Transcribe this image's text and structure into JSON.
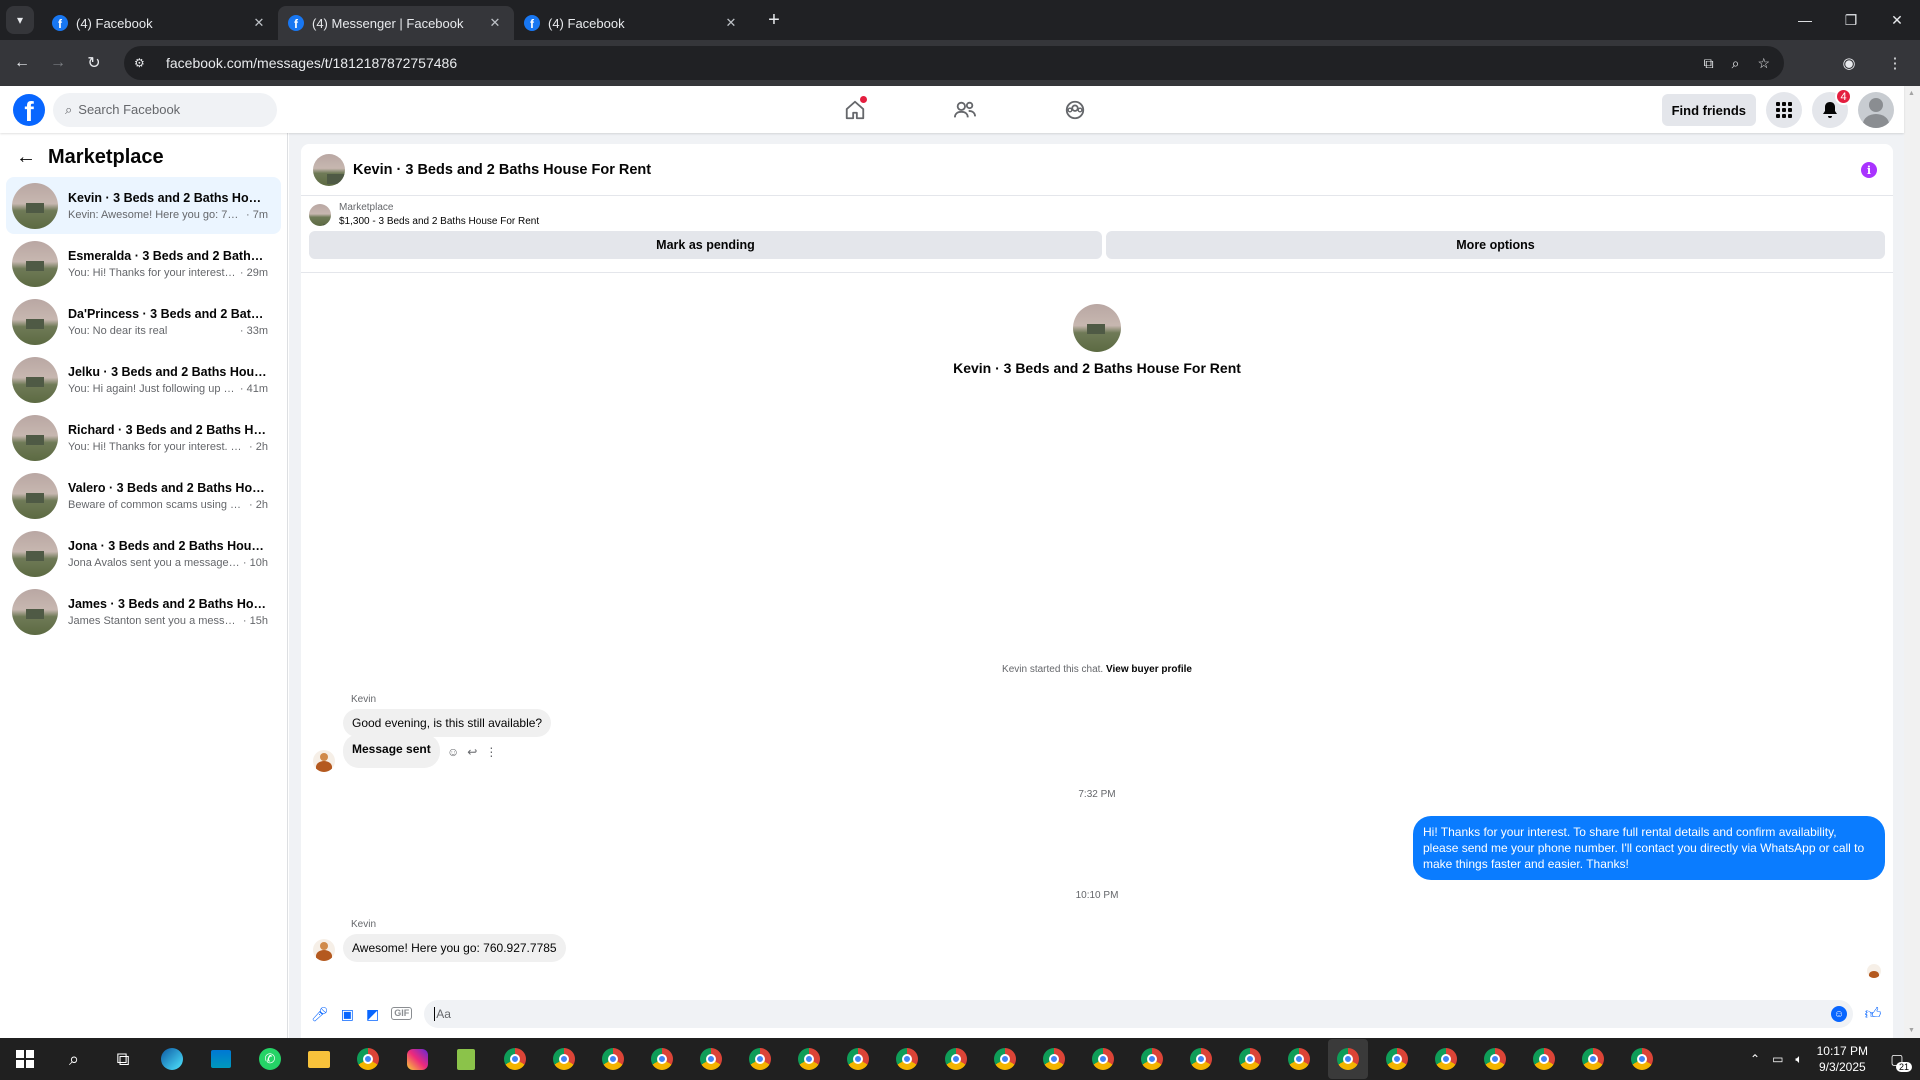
{
  "browser": {
    "tabs": [
      {
        "title": "(4) Facebook",
        "active": false
      },
      {
        "title": "(4) Messenger | Facebook",
        "active": true
      },
      {
        "title": "(4) Facebook",
        "active": false
      }
    ],
    "url": "facebook.com/messages/t/1812187872757486"
  },
  "fb_header": {
    "search_placeholder": "Search Facebook",
    "find_friends_label": "Find friends",
    "notification_count": "4"
  },
  "left_panel": {
    "title": "Marketplace",
    "conversations": [
      {
        "name": "Kevin · 3 Beds and 2 Baths House ...",
        "last": "Kevin: Awesome! Here you go: 760.9...",
        "time": "· 7m",
        "active": true
      },
      {
        "name": "Esmeralda · 3 Beds and 2 Baths Ho...",
        "last": "You: Hi! Thanks for your interest. To ...",
        "time": "· 29m",
        "active": false
      },
      {
        "name": "Da'Princess · 3 Beds and 2 Baths H...",
        "last": "You: No dear its real",
        "time": "· 33m",
        "active": false
      },
      {
        "name": "Jelku · 3 Beds and 2 Baths House F...",
        "last": "You: Hi again! Just following up in c...",
        "time": "· 41m",
        "active": false
      },
      {
        "name": "Richard · 3 Beds and 2 Baths Hous...",
        "last": "You: Hi! Thanks for your interest. To sh...",
        "time": "· 2h",
        "active": false
      },
      {
        "name": "Valero · 3 Beds and 2 Baths House ...",
        "last": "Beware of common scams using pay...",
        "time": "· 2h",
        "active": false
      },
      {
        "name": "Jona · 3 Beds and 2 Baths House F...",
        "last": "Jona Avalos sent you a message abo...",
        "time": "· 10h",
        "active": false
      },
      {
        "name": "James · 3 Beds and 2 Baths House ...",
        "last": "James Stanton sent you a message a...",
        "time": "· 15h",
        "active": false
      }
    ]
  },
  "chat": {
    "title": "Kevin · 3 Beds and 2 Baths House For Rent",
    "listing_category": "Marketplace",
    "listing_price_title": "$1,300 - 3 Beds and 2 Baths House For Rent",
    "mark_pending_label": "Mark as pending",
    "more_options_label": "More options",
    "profile_name": "Kevin · 3 Beds and 2 Baths House For Rent",
    "started_text": "Kevin started this chat.",
    "view_buyer_profile": "View buyer profile",
    "messages": {
      "sender1": "Kevin",
      "msg1": "Good evening, is this still available?",
      "msg2": "Message sent",
      "time1": "7:32 PM",
      "outgoing": "Hi! Thanks for your interest. To share full rental details and confirm availability, please send me your phone number. I'll contact you directly via WhatsApp or call to make things faster and easier. Thanks!",
      "time2": "10:10 PM",
      "sender2": "Kevin",
      "msg3": "Awesome! Here you go: 760.927.7785"
    },
    "composer_placeholder": "Aa"
  },
  "taskbar": {
    "time": "10:17 PM",
    "date": "9/3/2025",
    "notification_count": "21"
  },
  "colors": {
    "facebook_blue": "#0866ff",
    "messenger_blue": "#0a7cff",
    "info_purple": "#a933ff"
  }
}
